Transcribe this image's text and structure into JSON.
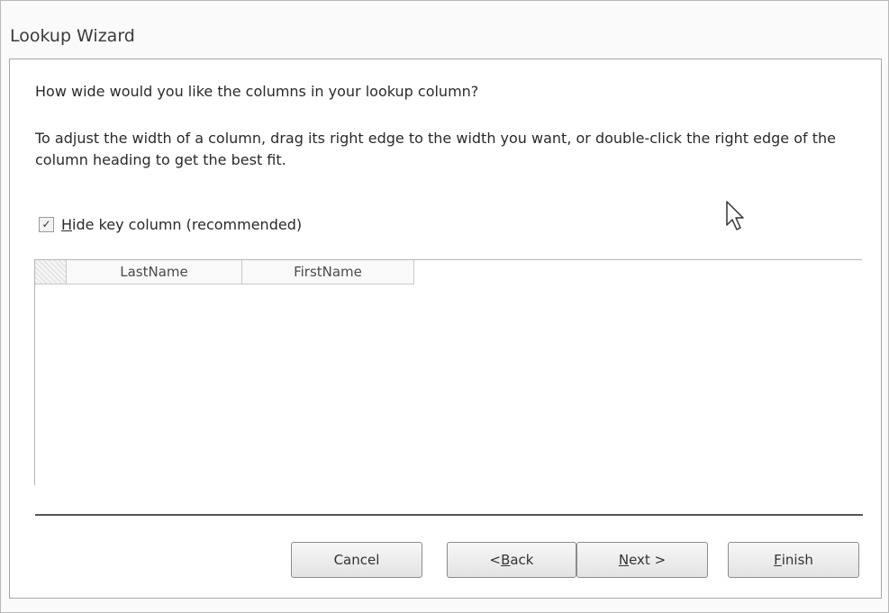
{
  "window": {
    "title": "Lookup Wizard"
  },
  "dialog": {
    "question": "How wide would you like the columns in your lookup column?",
    "instructions": "To adjust the width of a column, drag its right edge to the width you want, or double-click the right edge of the column heading to get the best fit.",
    "checkbox": {
      "hotkey": "H",
      "label_rest": "ide key column (recommended)",
      "checked": true,
      "check_mark": "✓"
    },
    "columns": [
      "LastName",
      "FirstName"
    ]
  },
  "buttons": {
    "cancel": "Cancel",
    "back_prefix": "< ",
    "back_hotkey": "B",
    "back_rest": "ack",
    "next_hotkey": "N",
    "next_rest": "ext >",
    "finish_hotkey": "F",
    "finish_rest": "inish"
  },
  "icons": {
    "cursor": "mouse-pointer-icon"
  }
}
